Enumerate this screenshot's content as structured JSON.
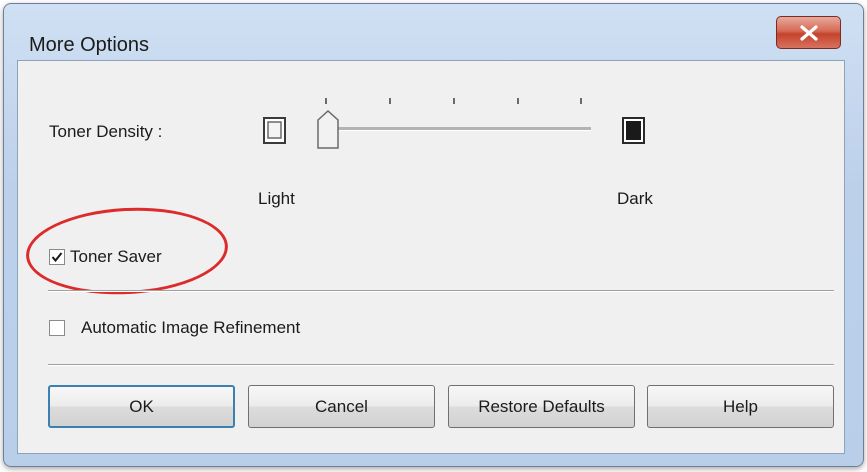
{
  "window": {
    "title": "More Options"
  },
  "toner_density": {
    "label": "Toner Density :",
    "light_label": "Light",
    "dark_label": "Dark",
    "ticks": 5,
    "level": 0
  },
  "toner_saver": {
    "label": "Toner Saver",
    "checked": true
  },
  "auto_refinement": {
    "label": "Automatic Image Refinement",
    "checked": false
  },
  "buttons": {
    "ok": "OK",
    "cancel": "Cancel",
    "restore": "Restore Defaults",
    "help": "Help"
  },
  "colors": {
    "annotation": "#dd2b2b",
    "close": "#c4432d",
    "focus": "#3c7fb1"
  }
}
